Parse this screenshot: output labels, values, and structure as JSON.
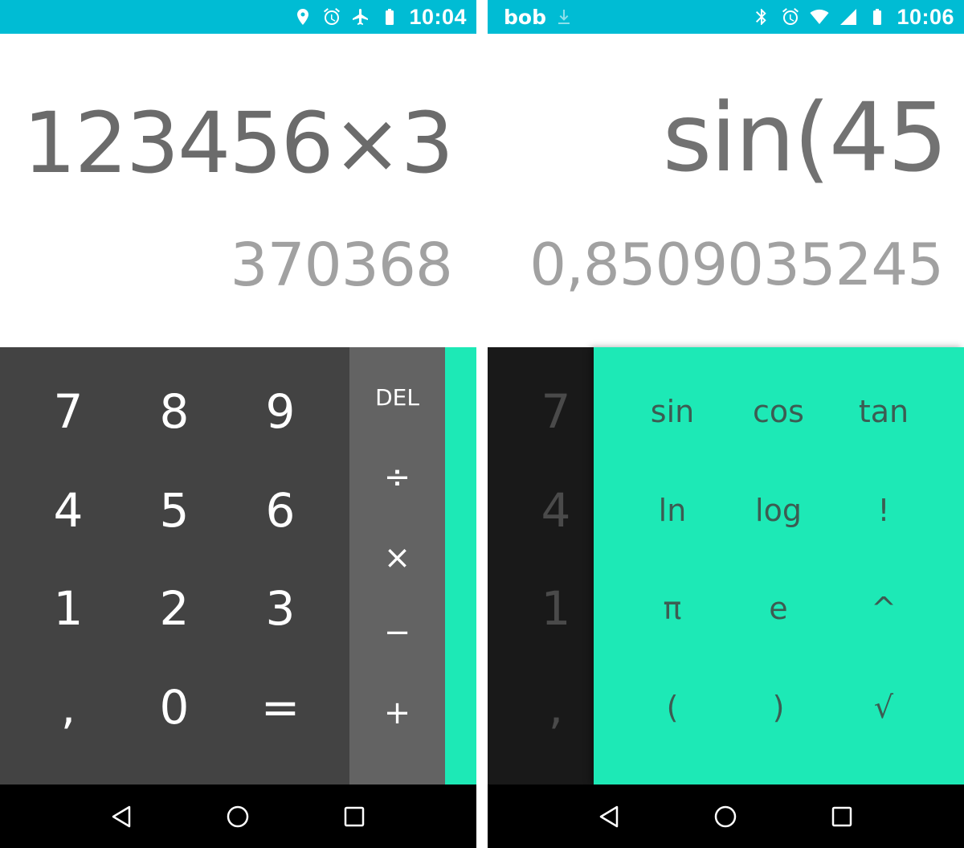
{
  "colors": {
    "status_bar": "#00bcd4",
    "display_bg": "#ffffff",
    "formula_text": "#6b6b6b",
    "result_text": "#a1a1a1",
    "numpad_bg": "#434343",
    "ops_bg": "#636363",
    "advanced_bg": "#1de9b6",
    "nav_bar": "#000000"
  },
  "left_screen": {
    "status": {
      "icons": [
        "location-icon",
        "alarm-icon",
        "airplane-icon",
        "battery-icon"
      ],
      "time": "10:04"
    },
    "display": {
      "formula": "123456×3",
      "result": "370368"
    },
    "numpad": {
      "keys": [
        "7",
        "8",
        "9",
        "4",
        "5",
        "6",
        "1",
        "2",
        "3",
        ",",
        "0",
        "="
      ]
    },
    "operators": {
      "keys": [
        "DEL",
        "÷",
        "×",
        "−",
        "+"
      ]
    }
  },
  "right_screen": {
    "status": {
      "carrier": "bob",
      "icons": [
        "download-icon",
        "bluetooth-icon",
        "alarm-icon",
        "wifi-icon",
        "signal-icon",
        "battery-icon"
      ],
      "time": "10:06"
    },
    "display": {
      "formula": "sin(45",
      "result": "0,8509035245"
    },
    "numpad_dimmed": {
      "keys": [
        "7",
        "4",
        "1",
        ","
      ]
    },
    "advanced": {
      "keys": [
        "sin",
        "cos",
        "tan",
        "ln",
        "log",
        "!",
        "π",
        "e",
        "^",
        "(",
        ")",
        "√"
      ]
    }
  },
  "nav": {
    "icons": [
      "back-icon",
      "home-icon",
      "recents-icon"
    ]
  }
}
